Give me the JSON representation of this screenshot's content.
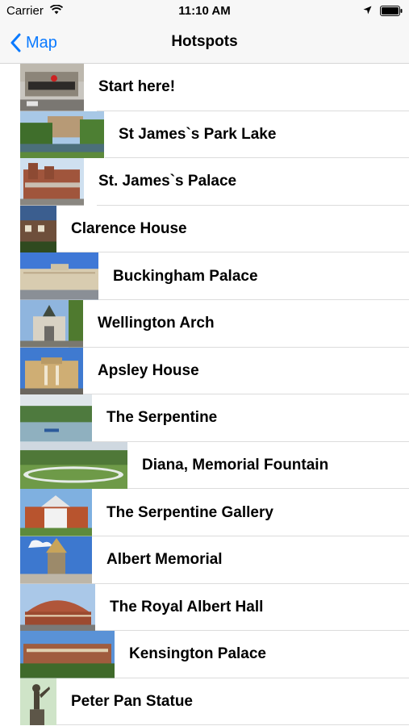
{
  "status_bar": {
    "carrier": "Carrier",
    "time": "11:10 AM"
  },
  "nav": {
    "back_label": "Map",
    "title": "Hotspots"
  },
  "colors": {
    "accent": "#0a7aff",
    "bar_background": "#f7f7f7",
    "separator": "#dcdcdc"
  },
  "hotspots": [
    {
      "label": "Start here!",
      "image": "street-building-photo"
    },
    {
      "label": "St James`s Park Lake",
      "image": "park-lake-photo"
    },
    {
      "label": "St. James`s Palace",
      "image": "brick-palace-photo"
    },
    {
      "label": "Clarence House",
      "image": "house-photo"
    },
    {
      "label": "Buckingham Palace",
      "image": "palace-photo"
    },
    {
      "label": "Wellington Arch",
      "image": "arch-photo"
    },
    {
      "label": "Apsley House",
      "image": "house-photo"
    },
    {
      "label": "The Serpentine",
      "image": "lake-photo"
    },
    {
      "label": "Diana, Memorial Fountain",
      "image": "fountain-photo"
    },
    {
      "label": "The Serpentine Gallery",
      "image": "gallery-photo"
    },
    {
      "label": "Albert Memorial",
      "image": "memorial-photo"
    },
    {
      "label": "The Royal Albert Hall",
      "image": "concert-hall-photo"
    },
    {
      "label": "Kensington Palace",
      "image": "palace-photo"
    },
    {
      "label": "Peter Pan Statue",
      "image": "statue-photo"
    }
  ]
}
